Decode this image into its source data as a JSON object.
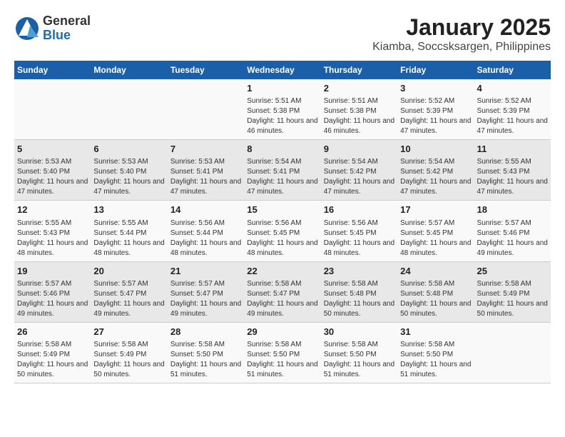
{
  "logo": {
    "general": "General",
    "blue": "Blue"
  },
  "title": "January 2025",
  "subtitle": "Kiamba, Soccsksargen, Philippines",
  "days_of_week": [
    "Sunday",
    "Monday",
    "Tuesday",
    "Wednesday",
    "Thursday",
    "Friday",
    "Saturday"
  ],
  "weeks": [
    [
      {
        "day": "",
        "sunrise": "",
        "sunset": "",
        "daylight": ""
      },
      {
        "day": "",
        "sunrise": "",
        "sunset": "",
        "daylight": ""
      },
      {
        "day": "",
        "sunrise": "",
        "sunset": "",
        "daylight": ""
      },
      {
        "day": "1",
        "sunrise": "Sunrise: 5:51 AM",
        "sunset": "Sunset: 5:38 PM",
        "daylight": "Daylight: 11 hours and 46 minutes."
      },
      {
        "day": "2",
        "sunrise": "Sunrise: 5:51 AM",
        "sunset": "Sunset: 5:38 PM",
        "daylight": "Daylight: 11 hours and 46 minutes."
      },
      {
        "day": "3",
        "sunrise": "Sunrise: 5:52 AM",
        "sunset": "Sunset: 5:39 PM",
        "daylight": "Daylight: 11 hours and 47 minutes."
      },
      {
        "day": "4",
        "sunrise": "Sunrise: 5:52 AM",
        "sunset": "Sunset: 5:39 PM",
        "daylight": "Daylight: 11 hours and 47 minutes."
      }
    ],
    [
      {
        "day": "5",
        "sunrise": "Sunrise: 5:53 AM",
        "sunset": "Sunset: 5:40 PM",
        "daylight": "Daylight: 11 hours and 47 minutes."
      },
      {
        "day": "6",
        "sunrise": "Sunrise: 5:53 AM",
        "sunset": "Sunset: 5:40 PM",
        "daylight": "Daylight: 11 hours and 47 minutes."
      },
      {
        "day": "7",
        "sunrise": "Sunrise: 5:53 AM",
        "sunset": "Sunset: 5:41 PM",
        "daylight": "Daylight: 11 hours and 47 minutes."
      },
      {
        "day": "8",
        "sunrise": "Sunrise: 5:54 AM",
        "sunset": "Sunset: 5:41 PM",
        "daylight": "Daylight: 11 hours and 47 minutes."
      },
      {
        "day": "9",
        "sunrise": "Sunrise: 5:54 AM",
        "sunset": "Sunset: 5:42 PM",
        "daylight": "Daylight: 11 hours and 47 minutes."
      },
      {
        "day": "10",
        "sunrise": "Sunrise: 5:54 AM",
        "sunset": "Sunset: 5:42 PM",
        "daylight": "Daylight: 11 hours and 47 minutes."
      },
      {
        "day": "11",
        "sunrise": "Sunrise: 5:55 AM",
        "sunset": "Sunset: 5:43 PM",
        "daylight": "Daylight: 11 hours and 47 minutes."
      }
    ],
    [
      {
        "day": "12",
        "sunrise": "Sunrise: 5:55 AM",
        "sunset": "Sunset: 5:43 PM",
        "daylight": "Daylight: 11 hours and 48 minutes."
      },
      {
        "day": "13",
        "sunrise": "Sunrise: 5:55 AM",
        "sunset": "Sunset: 5:44 PM",
        "daylight": "Daylight: 11 hours and 48 minutes."
      },
      {
        "day": "14",
        "sunrise": "Sunrise: 5:56 AM",
        "sunset": "Sunset: 5:44 PM",
        "daylight": "Daylight: 11 hours and 48 minutes."
      },
      {
        "day": "15",
        "sunrise": "Sunrise: 5:56 AM",
        "sunset": "Sunset: 5:45 PM",
        "daylight": "Daylight: 11 hours and 48 minutes."
      },
      {
        "day": "16",
        "sunrise": "Sunrise: 5:56 AM",
        "sunset": "Sunset: 5:45 PM",
        "daylight": "Daylight: 11 hours and 48 minutes."
      },
      {
        "day": "17",
        "sunrise": "Sunrise: 5:57 AM",
        "sunset": "Sunset: 5:45 PM",
        "daylight": "Daylight: 11 hours and 48 minutes."
      },
      {
        "day": "18",
        "sunrise": "Sunrise: 5:57 AM",
        "sunset": "Sunset: 5:46 PM",
        "daylight": "Daylight: 11 hours and 49 minutes."
      }
    ],
    [
      {
        "day": "19",
        "sunrise": "Sunrise: 5:57 AM",
        "sunset": "Sunset: 5:46 PM",
        "daylight": "Daylight: 11 hours and 49 minutes."
      },
      {
        "day": "20",
        "sunrise": "Sunrise: 5:57 AM",
        "sunset": "Sunset: 5:47 PM",
        "daylight": "Daylight: 11 hours and 49 minutes."
      },
      {
        "day": "21",
        "sunrise": "Sunrise: 5:57 AM",
        "sunset": "Sunset: 5:47 PM",
        "daylight": "Daylight: 11 hours and 49 minutes."
      },
      {
        "day": "22",
        "sunrise": "Sunrise: 5:58 AM",
        "sunset": "Sunset: 5:47 PM",
        "daylight": "Daylight: 11 hours and 49 minutes."
      },
      {
        "day": "23",
        "sunrise": "Sunrise: 5:58 AM",
        "sunset": "Sunset: 5:48 PM",
        "daylight": "Daylight: 11 hours and 50 minutes."
      },
      {
        "day": "24",
        "sunrise": "Sunrise: 5:58 AM",
        "sunset": "Sunset: 5:48 PM",
        "daylight": "Daylight: 11 hours and 50 minutes."
      },
      {
        "day": "25",
        "sunrise": "Sunrise: 5:58 AM",
        "sunset": "Sunset: 5:49 PM",
        "daylight": "Daylight: 11 hours and 50 minutes."
      }
    ],
    [
      {
        "day": "26",
        "sunrise": "Sunrise: 5:58 AM",
        "sunset": "Sunset: 5:49 PM",
        "daylight": "Daylight: 11 hours and 50 minutes."
      },
      {
        "day": "27",
        "sunrise": "Sunrise: 5:58 AM",
        "sunset": "Sunset: 5:49 PM",
        "daylight": "Daylight: 11 hours and 50 minutes."
      },
      {
        "day": "28",
        "sunrise": "Sunrise: 5:58 AM",
        "sunset": "Sunset: 5:50 PM",
        "daylight": "Daylight: 11 hours and 51 minutes."
      },
      {
        "day": "29",
        "sunrise": "Sunrise: 5:58 AM",
        "sunset": "Sunset: 5:50 PM",
        "daylight": "Daylight: 11 hours and 51 minutes."
      },
      {
        "day": "30",
        "sunrise": "Sunrise: 5:58 AM",
        "sunset": "Sunset: 5:50 PM",
        "daylight": "Daylight: 11 hours and 51 minutes."
      },
      {
        "day": "31",
        "sunrise": "Sunrise: 5:58 AM",
        "sunset": "Sunset: 5:50 PM",
        "daylight": "Daylight: 11 hours and 51 minutes."
      },
      {
        "day": "",
        "sunrise": "",
        "sunset": "",
        "daylight": ""
      }
    ]
  ]
}
